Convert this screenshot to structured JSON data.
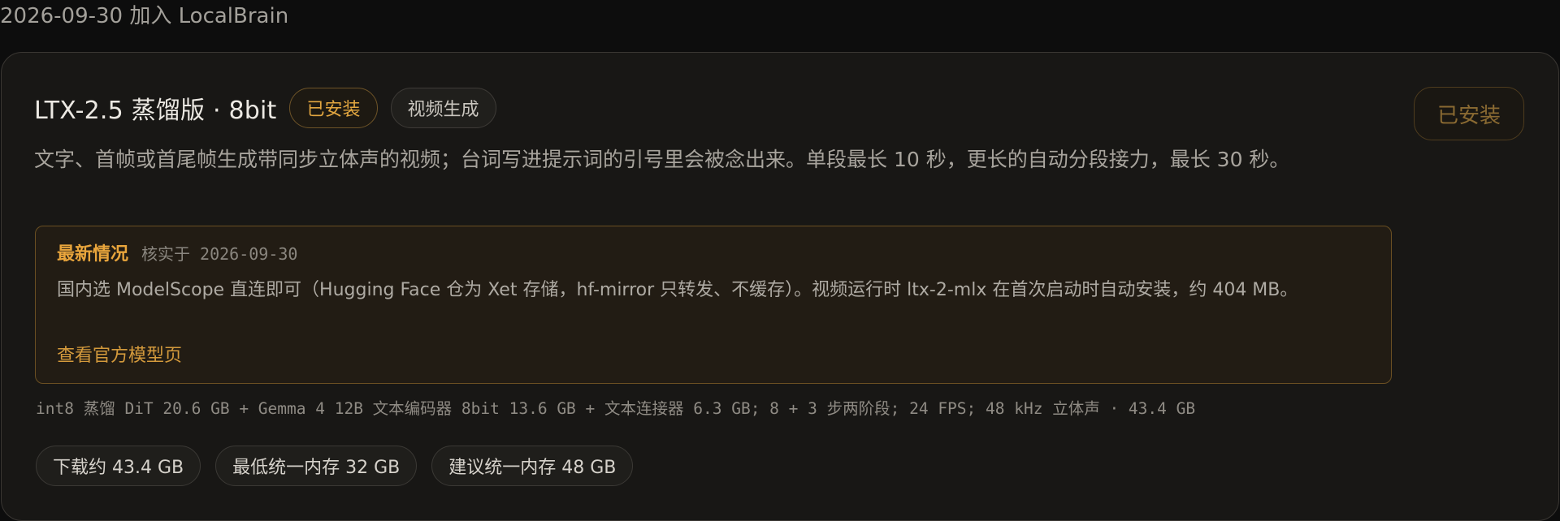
{
  "added_line": "2026-09-30 加入 LocalBrain",
  "model": {
    "title": "LTX-2.5 蒸馏版 · 8bit",
    "installed_badge": "已安装",
    "category_tag": "视频生成",
    "install_button": "已安装",
    "description": "文字、首帧或首尾帧生成带同步立体声的视频；台词写进提示词的引号里会被念出来。单段最长 10 秒，更长的自动分段接力，最长 30 秒。"
  },
  "latest": {
    "label": "最新情况",
    "verified": "核实于 2026-09-30",
    "text": "国内选 ModelScope 直连即可（Hugging Face 仓为 Xet 存储，hf-mirror 只转发、不缓存）。视频运行时 ltx-2-mlx 在首次启动时自动安装，约 404 MB。",
    "link": "查看官方模型页"
  },
  "specs": "int8 蒸馏 DiT 20.6 GB + Gemma 4 12B 文本编码器 8bit 13.6 GB + 文本连接器 6.3 GB; 8 + 3 步两阶段; 24 FPS; 48 kHz 立体声 · 43.4 GB",
  "chips": {
    "download": "下载约 43.4 GB",
    "min_memory": "最低统一内存 32 GB",
    "recommended_memory": "建议统一内存 48 GB"
  },
  "colors": {
    "accent": "#e2a640",
    "background": "#0d0d0d",
    "card": "#181715"
  }
}
